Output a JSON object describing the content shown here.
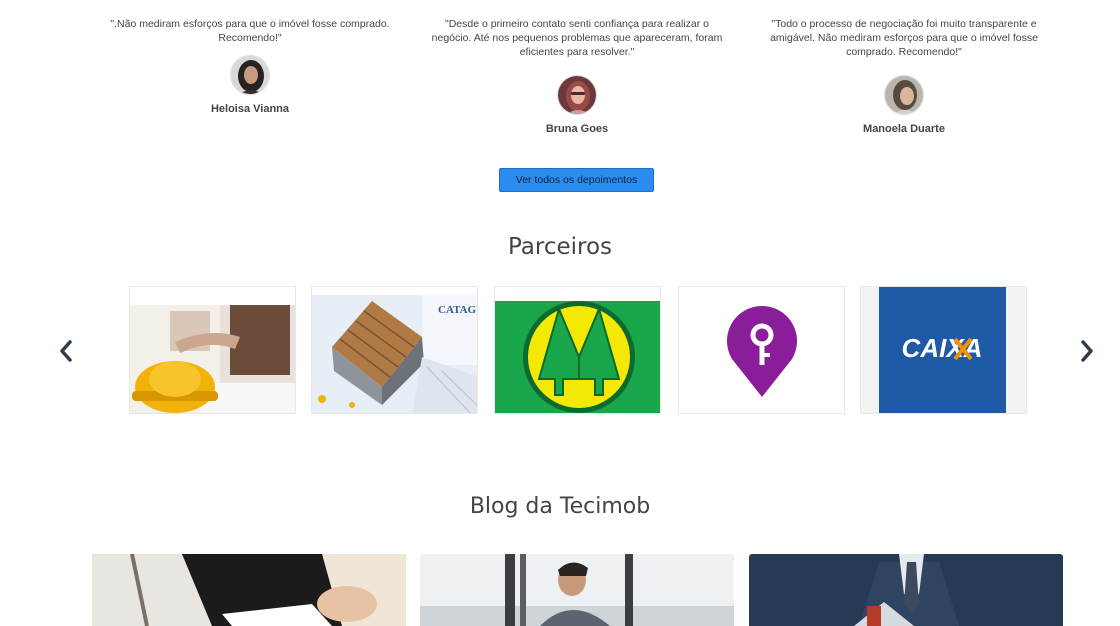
{
  "testimonials": [
    {
      "quote": "\".Não mediram esforços para que o imóvel fosse comprado. Recomendo!\"",
      "name": "Heloisa Vianna",
      "avatar_icon": "person-photo"
    },
    {
      "quote": "\"Desde o primeiro contato senti confiança para realizar o negócio. Até nos pequenos problemas que apareceram, foram eficientes para resolver.\"",
      "name": "Bruna Goes",
      "avatar_icon": "person-photo"
    },
    {
      "quote": "\"Todo o processo de negociação foi muito transparente e amigável. Não mediram esforços para que o imóvel fosse comprado. Recomendo!\"",
      "name": "Manoela Duarte",
      "avatar_icon": "person-photo"
    }
  ],
  "buttons": {
    "all_testimonials": "Ver todos os depoimentos"
  },
  "partners": {
    "title": "Parceiros",
    "prev_icon": "chevron-left-icon",
    "next_icon": "chevron-right-icon",
    "items": [
      {
        "kind": "photo",
        "subject": "handshake-helmet"
      },
      {
        "kind": "photo",
        "subject": "house-construction",
        "caption": "CATAGU"
      },
      {
        "kind": "logo",
        "subject": "green-yellow-trees"
      },
      {
        "kind": "logo",
        "subject": "purple-key-pin"
      },
      {
        "kind": "logo",
        "subject": "caixa",
        "text": "CAIXA"
      }
    ]
  },
  "blog": {
    "title": "Blog da Tecimob"
  },
  "colors": {
    "button_bg": "#2b8cf0",
    "caixa_blue": "#1f5aa6",
    "caixa_orange": "#f39200",
    "tree_green": "#1aa64a",
    "tree_yellow": "#f4e805",
    "key_purple": "#8a1e9a"
  }
}
